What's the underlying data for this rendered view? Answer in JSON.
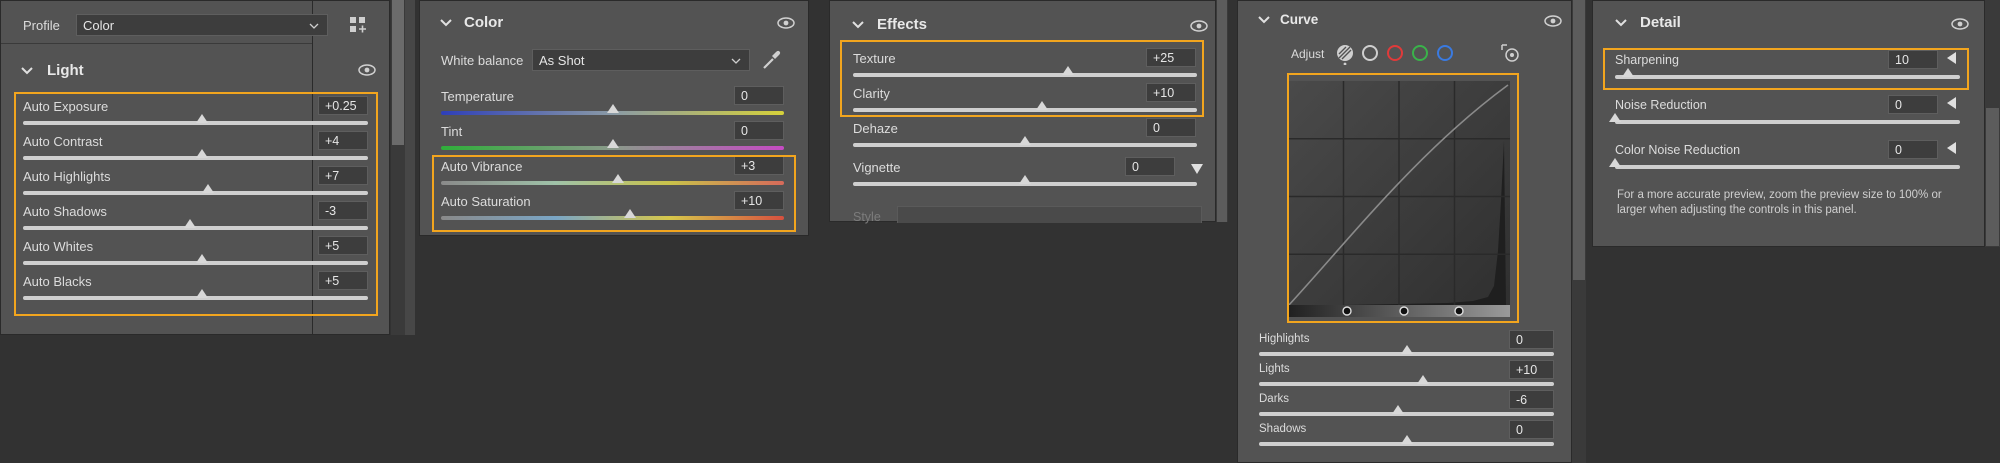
{
  "profile_bar": {
    "label": "Profile",
    "value": "Color"
  },
  "light": {
    "title": "Light",
    "rows": [
      {
        "label": "Auto Exposure",
        "value": "+0.25",
        "pos": 0.52
      },
      {
        "label": "Auto Contrast",
        "value": "+4",
        "pos": 0.52
      },
      {
        "label": "Auto Highlights",
        "value": "+7",
        "pos": 0.535
      },
      {
        "label": "Auto Shadows",
        "value": "-3",
        "pos": 0.485
      },
      {
        "label": "Auto Whites",
        "value": "+5",
        "pos": 0.52
      },
      {
        "label": "Auto Blacks",
        "value": "+5",
        "pos": 0.52
      }
    ]
  },
  "color": {
    "title": "Color",
    "white_balance_label": "White balance",
    "white_balance_value": "As Shot",
    "rows": [
      {
        "label": "Temperature",
        "value": "0",
        "pos": 0.5
      },
      {
        "label": "Tint",
        "value": "0",
        "pos": 0.5
      },
      {
        "label": "Auto Vibrance",
        "value": "+3",
        "pos": 0.515
      },
      {
        "label": "Auto Saturation",
        "value": "+10",
        "pos": 0.55
      }
    ]
  },
  "effects": {
    "title": "Effects",
    "rows": [
      {
        "label": "Texture",
        "value": "+25",
        "pos": 0.625
      },
      {
        "label": "Clarity",
        "value": "+10",
        "pos": 0.55
      },
      {
        "label": "Dehaze",
        "value": "0",
        "pos": 0.5
      },
      {
        "label": "Vignette",
        "value": "0",
        "pos": 0.5
      }
    ],
    "style_label": "Style"
  },
  "curve": {
    "title": "Curve",
    "adjust_label": "Adjust",
    "rows": [
      {
        "label": "Highlights",
        "value": "0",
        "pos": 0.5
      },
      {
        "label": "Lights",
        "value": "+10",
        "pos": 0.555
      },
      {
        "label": "Darks",
        "value": "-6",
        "pos": 0.47
      },
      {
        "label": "Shadows",
        "value": "0",
        "pos": 0.5
      }
    ],
    "channel_colors": [
      "#cfcfcf",
      "#e03a3a",
      "#3ab34a",
      "#3a7ae0"
    ]
  },
  "detail": {
    "title": "Detail",
    "rows": [
      {
        "label": "Sharpening",
        "value": "10",
        "pos": 0.037
      },
      {
        "label": "Noise Reduction",
        "value": "0",
        "pos": 0.0
      },
      {
        "label": "Color Noise Reduction",
        "value": "0",
        "pos": 0.0
      }
    ],
    "note": "For a more accurate preview, zoom the preview size to 100% or larger when adjusting the controls in this panel."
  },
  "accent_color": "#f2a51e"
}
